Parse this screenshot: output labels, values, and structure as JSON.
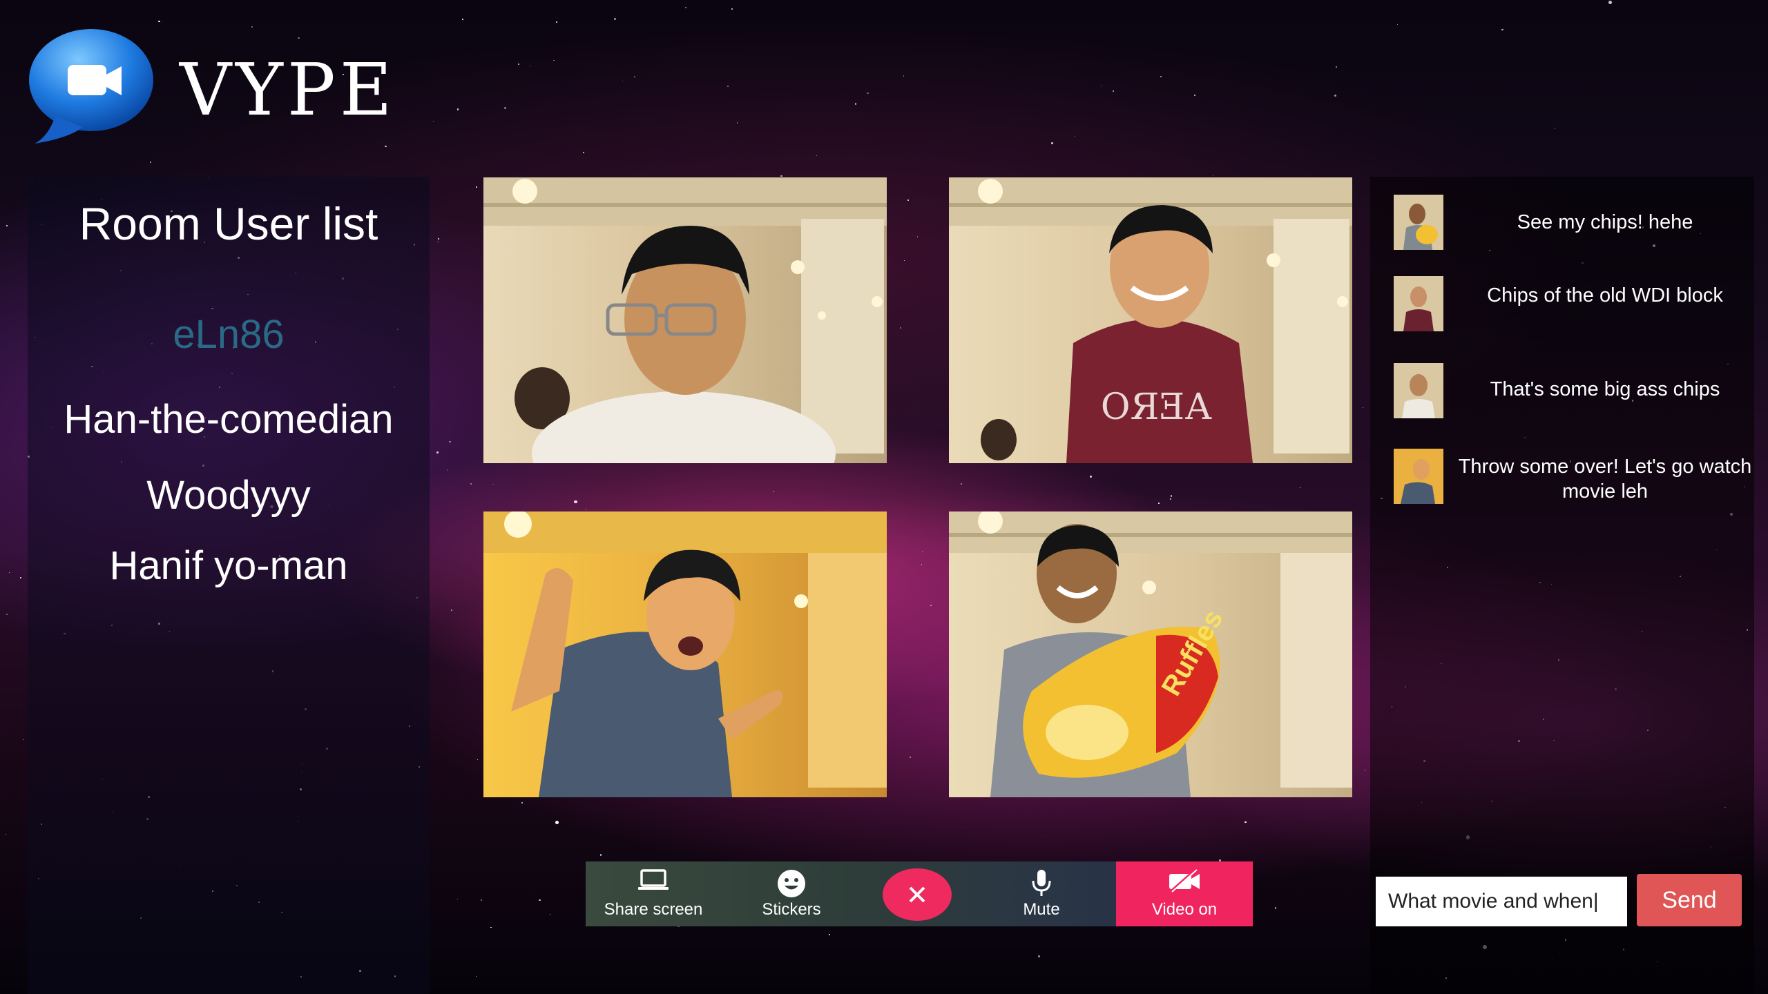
{
  "app": {
    "name": "VYPE"
  },
  "userlist": {
    "title": "Room User list",
    "users": [
      "eLn86",
      "Han-the-comedian",
      "Woodyyy",
      "Hanif yo-man"
    ]
  },
  "chat": {
    "messages": [
      {
        "text": "See my chips! hehe",
        "avatar": "person-with-chips-icon"
      },
      {
        "text": "Chips of the old WDI block",
        "avatar": "person-maroon-shirt-icon"
      },
      {
        "text": "That's some big ass chips",
        "avatar": "person-glasses-icon"
      },
      {
        "text": "Throw some over! Let's go watch movie leh",
        "avatar": "person-waving-icon"
      }
    ],
    "input_value": "What movie and when|",
    "send_label": "Send"
  },
  "controls": {
    "share_screen": "Share screen",
    "stickers": "Stickers",
    "mute": "Mute",
    "video_on": "Video on"
  },
  "colors": {
    "end_call": "#ee2a5e",
    "video_on": "#f0245e",
    "send": "#e05555",
    "active_user": "#2a6a86"
  }
}
